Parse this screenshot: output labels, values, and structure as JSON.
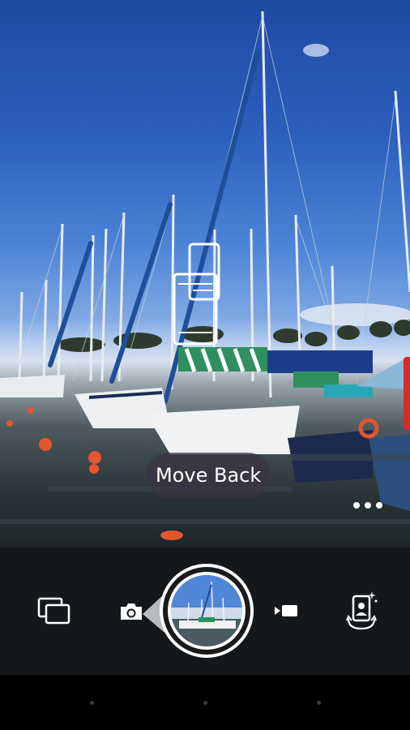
{
  "viewfinder": {
    "toast_text": "Move Back",
    "pose_hint_icon": "phone-move-back-icon",
    "more_icon": "more-dots-icon"
  },
  "controls": {
    "gallery_icon": "gallery-icon",
    "photo_mode_icon": "camera-icon",
    "shutter_icon": "shutter-button-preview",
    "video_mode_icon": "video-camera-icon",
    "selfie_icon": "switch-camera-icon"
  },
  "navbar": {
    "buttons": [
      "back-icon",
      "home-icon",
      "recents-icon"
    ]
  },
  "colors": {
    "toast_bg": "#3c3246",
    "controls_bg": "#14181a",
    "accent": "#ffffff"
  }
}
